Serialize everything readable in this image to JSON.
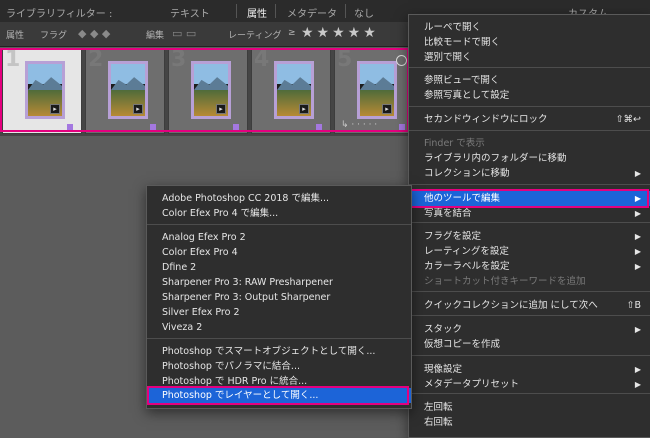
{
  "filter_bar": {
    "label": "ライブラリフィルター :",
    "tabs": [
      "テキスト",
      "属性",
      "メタデータ",
      "なし"
    ],
    "active_tab": "属性",
    "right_label": "カスタム..."
  },
  "attribute_bar": {
    "label": "属性",
    "flag_label": "フラグ",
    "edit_label": "編集",
    "rating_label": "レーティング",
    "rating_op": "≥",
    "stars": "★★★★★",
    "star_count": 5
  },
  "filmstrip": {
    "cells": [
      {
        "number": "1",
        "selected": true
      },
      {
        "number": "2",
        "selected": true
      },
      {
        "number": "3",
        "selected": true
      },
      {
        "number": "4",
        "selected": true
      },
      {
        "number": "5",
        "selected": true
      }
    ],
    "badge_glyph": "▸",
    "stack_glyph": "↳ · · · · ·"
  },
  "right_menu": {
    "items": [
      {
        "label": "ルーペで開く",
        "shortcut": "",
        "arrow": false,
        "disabled": false
      },
      {
        "label": "比較モードで開く",
        "shortcut": "",
        "arrow": false,
        "disabled": false
      },
      {
        "label": "選別で開く",
        "shortcut": "",
        "arrow": false,
        "disabled": false
      },
      {
        "label": "参照ビューで開く",
        "shortcut": "",
        "arrow": false,
        "disabled": false
      },
      {
        "label": "参照写真として設定",
        "shortcut": "",
        "arrow": false,
        "disabled": false
      },
      {
        "label": "セカンドウィンドウにロック",
        "shortcut": "⇧⌘↩",
        "arrow": false,
        "disabled": false
      },
      {
        "label": "Finder で表示",
        "shortcut": "",
        "arrow": false,
        "disabled": true
      },
      {
        "label": "ライブラリ内のフォルダーに移動",
        "shortcut": "",
        "arrow": false,
        "disabled": false
      },
      {
        "label": "コレクションに移動",
        "shortcut": "",
        "arrow": true,
        "disabled": false
      },
      {
        "label": "他のツールで編集",
        "shortcut": "",
        "arrow": true,
        "disabled": false,
        "highlight": true
      },
      {
        "label": "写真を結合",
        "shortcut": "",
        "arrow": true,
        "disabled": false
      },
      {
        "label": "フラグを設定",
        "shortcut": "",
        "arrow": true,
        "disabled": false
      },
      {
        "label": "レーティングを設定",
        "shortcut": "",
        "arrow": true,
        "disabled": false
      },
      {
        "label": "カラーラベルを設定",
        "shortcut": "",
        "arrow": true,
        "disabled": false
      },
      {
        "label": "ショートカット付きキーワードを追加",
        "shortcut": "",
        "arrow": false,
        "disabled": true
      },
      {
        "label": "クイックコレクションに追加 にして次へ",
        "shortcut": "⇧B",
        "arrow": false,
        "disabled": false
      },
      {
        "label": "スタック",
        "shortcut": "",
        "arrow": true,
        "disabled": false
      },
      {
        "label": "仮想コピーを作成",
        "shortcut": "",
        "arrow": false,
        "disabled": false
      },
      {
        "label": "現像設定",
        "shortcut": "",
        "arrow": true,
        "disabled": false
      },
      {
        "label": "メタデータプリセット",
        "shortcut": "",
        "arrow": true,
        "disabled": false
      },
      {
        "label": "左回転",
        "shortcut": "",
        "arrow": false,
        "disabled": false
      },
      {
        "label": "右回転",
        "shortcut": "",
        "arrow": false,
        "disabled": false
      }
    ]
  },
  "left_menu": {
    "items": [
      {
        "label": "Adobe Photoshop CC 2018 で編集..."
      },
      {
        "label": "Color Efex Pro 4 で編集..."
      },
      {
        "label": "Analog Efex Pro 2"
      },
      {
        "label": "Color Efex Pro 4"
      },
      {
        "label": "Dfine 2"
      },
      {
        "label": "Sharpener Pro 3: RAW Presharpener"
      },
      {
        "label": "Sharpener Pro 3: Output Sharpener"
      },
      {
        "label": "Silver Efex Pro 2"
      },
      {
        "label": "Viveza 2"
      },
      {
        "label": "Photoshop でスマートオブジェクトとして開く..."
      },
      {
        "label": "Photoshop でパノラマに結合..."
      },
      {
        "label": "Photoshop で HDR Pro に統合..."
      },
      {
        "label": "Photoshop でレイヤーとして開く...",
        "highlight": true
      }
    ]
  },
  "colors": {
    "highlight": "#1c64d8",
    "annotation": "#e4007f",
    "thumb_border": "#b7a0d6"
  }
}
